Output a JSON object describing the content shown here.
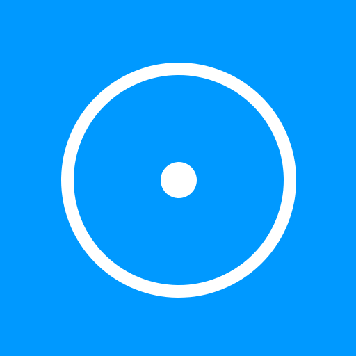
{
  "icon": {
    "name": "record-icon",
    "background_color": "#0099ff",
    "foreground_color": "#ffffff"
  }
}
